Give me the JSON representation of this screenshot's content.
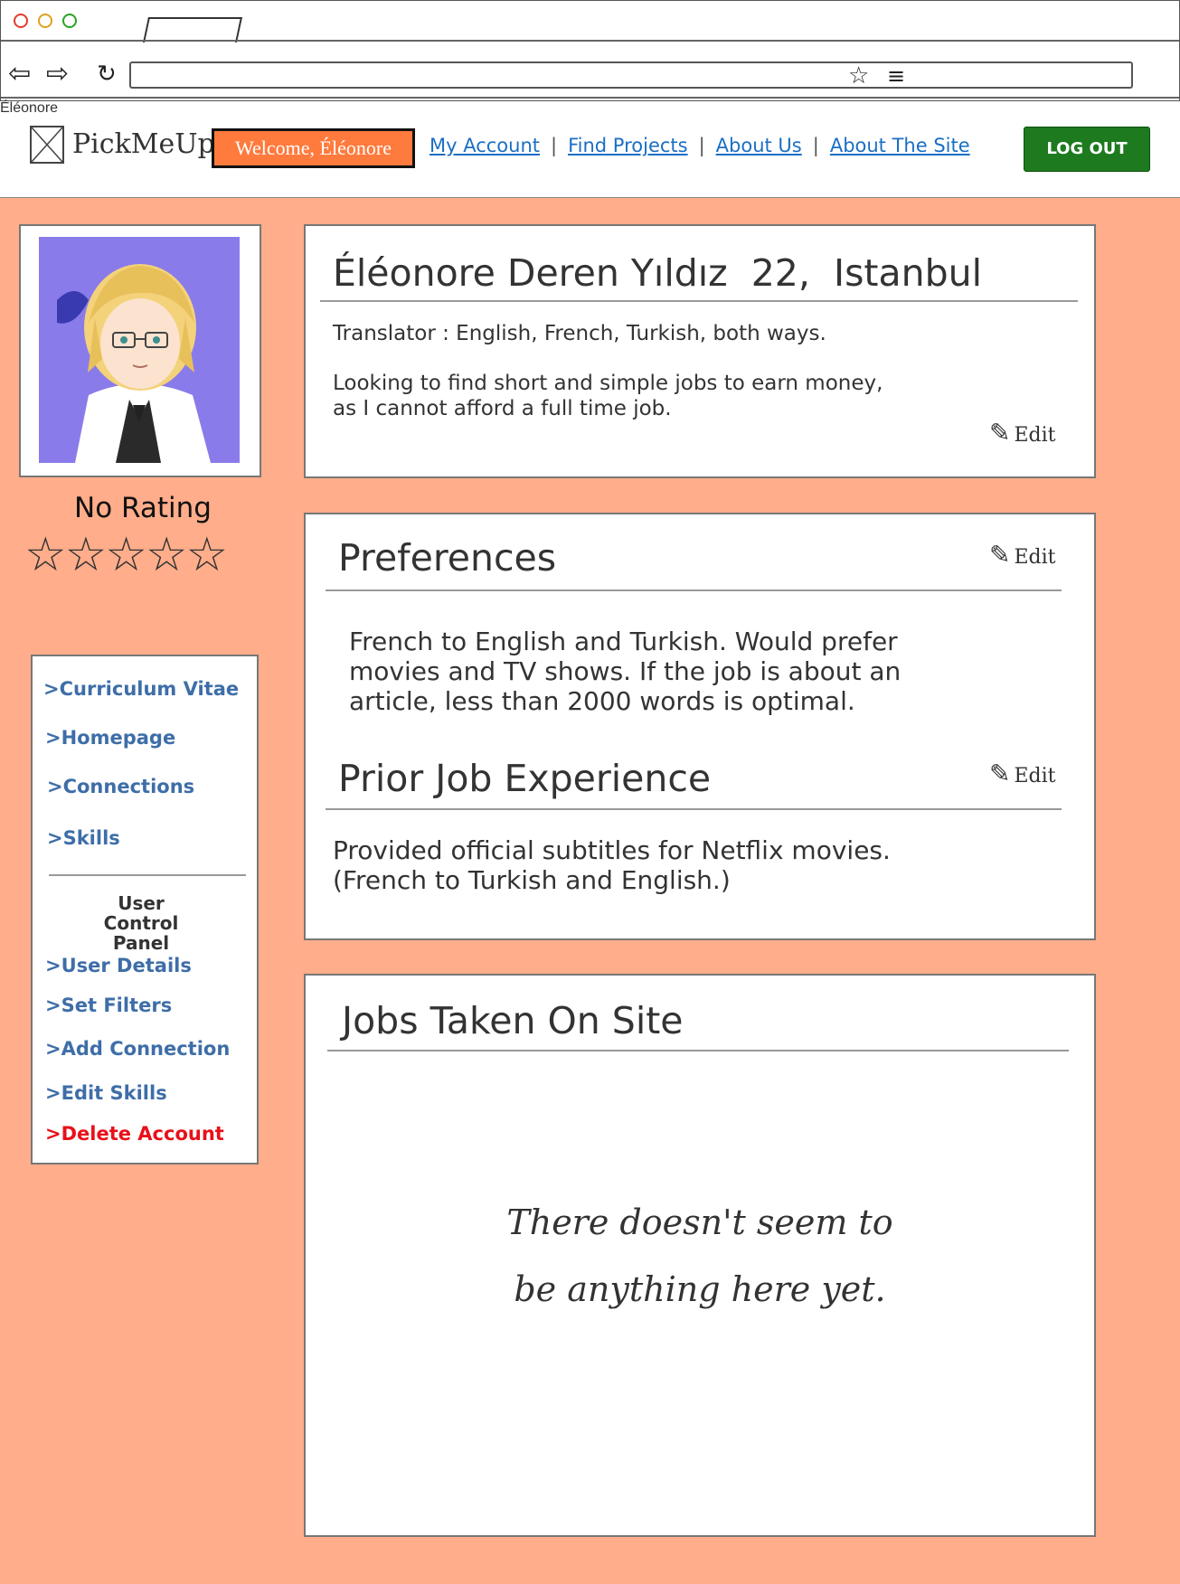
{
  "browser": {
    "page_tab_label": "Éléonore",
    "dot_colors": [
      "#e33b2e",
      "#e0a020",
      "#27a327"
    ]
  },
  "header": {
    "logo": "PickMeUp",
    "welcome": "Welcome, Éléonore",
    "nav": [
      "My Account",
      "Find Projects",
      "About Us",
      "About The Site"
    ],
    "separator": "|",
    "logout": "LOG OUT"
  },
  "profile": {
    "rating_label": "No Rating",
    "stars": "☆☆☆☆☆",
    "rating_value": 0,
    "rating_max": 5
  },
  "sidebar": {
    "links": [
      ">Curriculum Vitae",
      ">Homepage",
      ">Connections",
      ">Skills"
    ],
    "control_title": "User Control Panel",
    "control_links": [
      ">User Details",
      ">Set Filters",
      ">Add Connection",
      ">Edit Skills"
    ],
    "delete": ">Delete Account"
  },
  "card_info": {
    "title": "Éléonore Deren Yıldız  22,  Istanbul",
    "line1": "Translator : English, French, Turkish, both ways.",
    "line2": "Looking to find short and simple jobs to earn money,",
    "line3": "as I cannot afford a full time job.",
    "edit": "Edit"
  },
  "card_prefs": {
    "title": "Preferences",
    "lines": [
      "French to English and Turkish. Would prefer",
      "movies and TV shows. If the job is about an",
      "article, less than 2000 words is optimal."
    ],
    "edit": "Edit",
    "prior_title": "Prior Job Experience",
    "prior_lines": [
      "Provided official subtitles for Netflix movies.",
      "(French to Turkish and English.)"
    ],
    "prior_edit": "Edit"
  },
  "card_jobs": {
    "title": "Jobs Taken On Site",
    "empty_line1": "There doesn't seem to",
    "empty_line2": "be anything here yet."
  }
}
